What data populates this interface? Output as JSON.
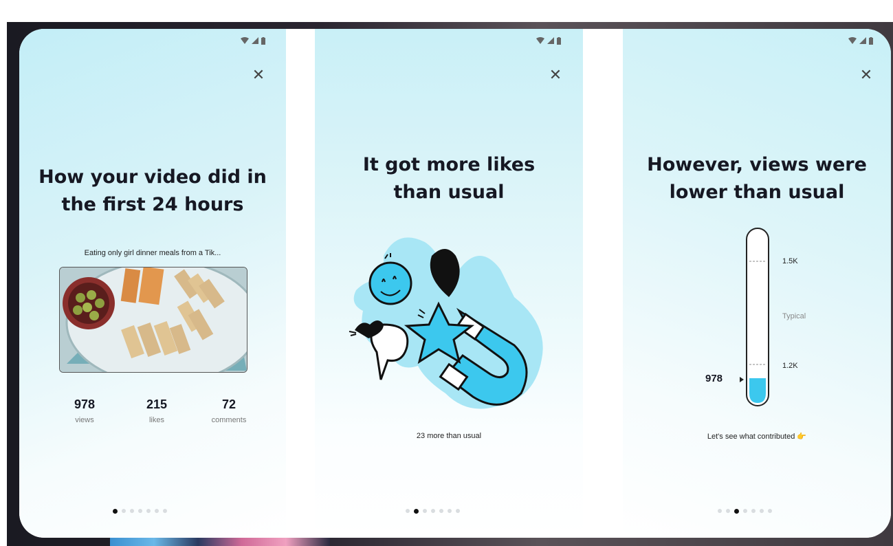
{
  "panel1": {
    "heading": "How your video did in the first 24 hours",
    "caption": "Eating only girl dinner meals from a Tik...",
    "stats": [
      {
        "value": "978",
        "label": "views"
      },
      {
        "value": "215",
        "label": "likes"
      },
      {
        "value": "72",
        "label": "comments"
      }
    ],
    "page_index": 0,
    "page_count": 7
  },
  "panel2": {
    "heading": "It got more likes than usual",
    "subtext": "23 more than usual",
    "page_index": 1,
    "page_count": 7
  },
  "panel3": {
    "heading": "However, views were lower than usual",
    "range_high": "1.5K",
    "typical_label": "Typical",
    "range_low": "1.2K",
    "current_value": "978",
    "subtext": "Let's see what contributed 👉",
    "page_index": 2,
    "page_count": 7
  },
  "close_glyph": "✕",
  "colors": {
    "accent": "#3cc8ee",
    "text": "#161823"
  }
}
